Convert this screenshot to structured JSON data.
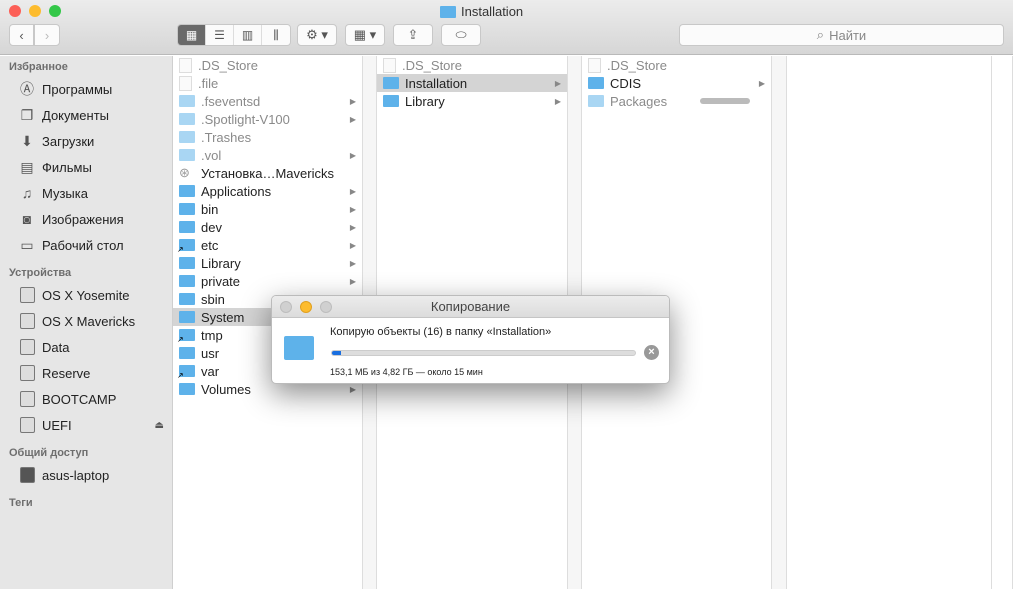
{
  "window": {
    "title": "Installation",
    "colors": {
      "close": "#fc5f57",
      "minimize": "#fdbc2e",
      "zoom": "#33c748",
      "accent": "#1a6fe0"
    }
  },
  "toolbar": {
    "back_icon": "chevron-left-icon",
    "forward_icon": "chevron-right-icon",
    "view_modes": [
      "icon-view-icon",
      "list-view-icon",
      "column-view-icon",
      "coverflow-icon"
    ],
    "active_view": "icon-view-icon",
    "search_placeholder": "Найти"
  },
  "sidebar": {
    "favorites_header": "Избранное",
    "favorites": [
      {
        "label": "Программы",
        "icon": "applications-icon"
      },
      {
        "label": "Документы",
        "icon": "documents-icon"
      },
      {
        "label": "Загрузки",
        "icon": "downloads-icon"
      },
      {
        "label": "Фильмы",
        "icon": "movies-icon"
      },
      {
        "label": "Музыка",
        "icon": "music-icon"
      },
      {
        "label": "Изображения",
        "icon": "camera-icon"
      },
      {
        "label": "Рабочий стол",
        "icon": "desktop-icon"
      }
    ],
    "devices_header": "Устройства",
    "devices": [
      {
        "label": "OS X Yosemite"
      },
      {
        "label": "OS X Mavericks"
      },
      {
        "label": "Data"
      },
      {
        "label": "Reserve"
      },
      {
        "label": "BOOTCAMP"
      },
      {
        "label": "UEFI",
        "eject": true
      }
    ],
    "shared_header": "Общий доступ",
    "shared": [
      {
        "label": "asus-laptop"
      }
    ],
    "tags_header": "Теги"
  },
  "columns": [
    [
      {
        "name": ".DS_Store",
        "type": "doc",
        "dim": true
      },
      {
        "name": ".file",
        "type": "doc",
        "dim": true
      },
      {
        "name": ".fseventsd",
        "type": "folder",
        "dim": true,
        "arrow": true
      },
      {
        "name": ".Spotlight-V100",
        "type": "folder",
        "dim": true,
        "arrow": true
      },
      {
        "name": ".Trashes",
        "type": "folder",
        "dim": true
      },
      {
        "name": ".vol",
        "type": "folder",
        "dim": true,
        "arrow": true
      },
      {
        "name": "Установка…Mavericks",
        "type": "app"
      },
      {
        "name": "Applications",
        "type": "folder",
        "arrow": true
      },
      {
        "name": "bin",
        "type": "folder",
        "arrow": true
      },
      {
        "name": "dev",
        "type": "folder",
        "arrow": true
      },
      {
        "name": "etc",
        "type": "alias",
        "arrow": true
      },
      {
        "name": "Library",
        "type": "folder",
        "arrow": true
      },
      {
        "name": "private",
        "type": "folder",
        "arrow": true
      },
      {
        "name": "sbin",
        "type": "folder",
        "arrow": true
      },
      {
        "name": "System",
        "type": "folder",
        "arrow": true,
        "selected": true
      },
      {
        "name": "tmp",
        "type": "alias",
        "arrow": true
      },
      {
        "name": "usr",
        "type": "folder",
        "arrow": true
      },
      {
        "name": "var",
        "type": "alias",
        "arrow": true
      },
      {
        "name": "Volumes",
        "type": "folder",
        "arrow": true
      }
    ],
    [
      {
        "name": ".DS_Store",
        "type": "doc",
        "dim": true
      },
      {
        "name": "Installation",
        "type": "folder",
        "arrow": true,
        "selected": true
      },
      {
        "name": "Library",
        "type": "folder",
        "arrow": true
      }
    ],
    [
      {
        "name": ".DS_Store",
        "type": "doc",
        "dim": true
      },
      {
        "name": "CDIS",
        "type": "folder",
        "arrow": true
      },
      {
        "name": "Packages",
        "type": "folder",
        "dim": true,
        "copying": true
      }
    ]
  ],
  "dialog": {
    "title": "Копирование",
    "message": "Копирую объекты (16) в папку «Installation»",
    "status": "153,1 МБ из 4,82 ГБ — около 15 мин",
    "progress_percent": 3
  }
}
